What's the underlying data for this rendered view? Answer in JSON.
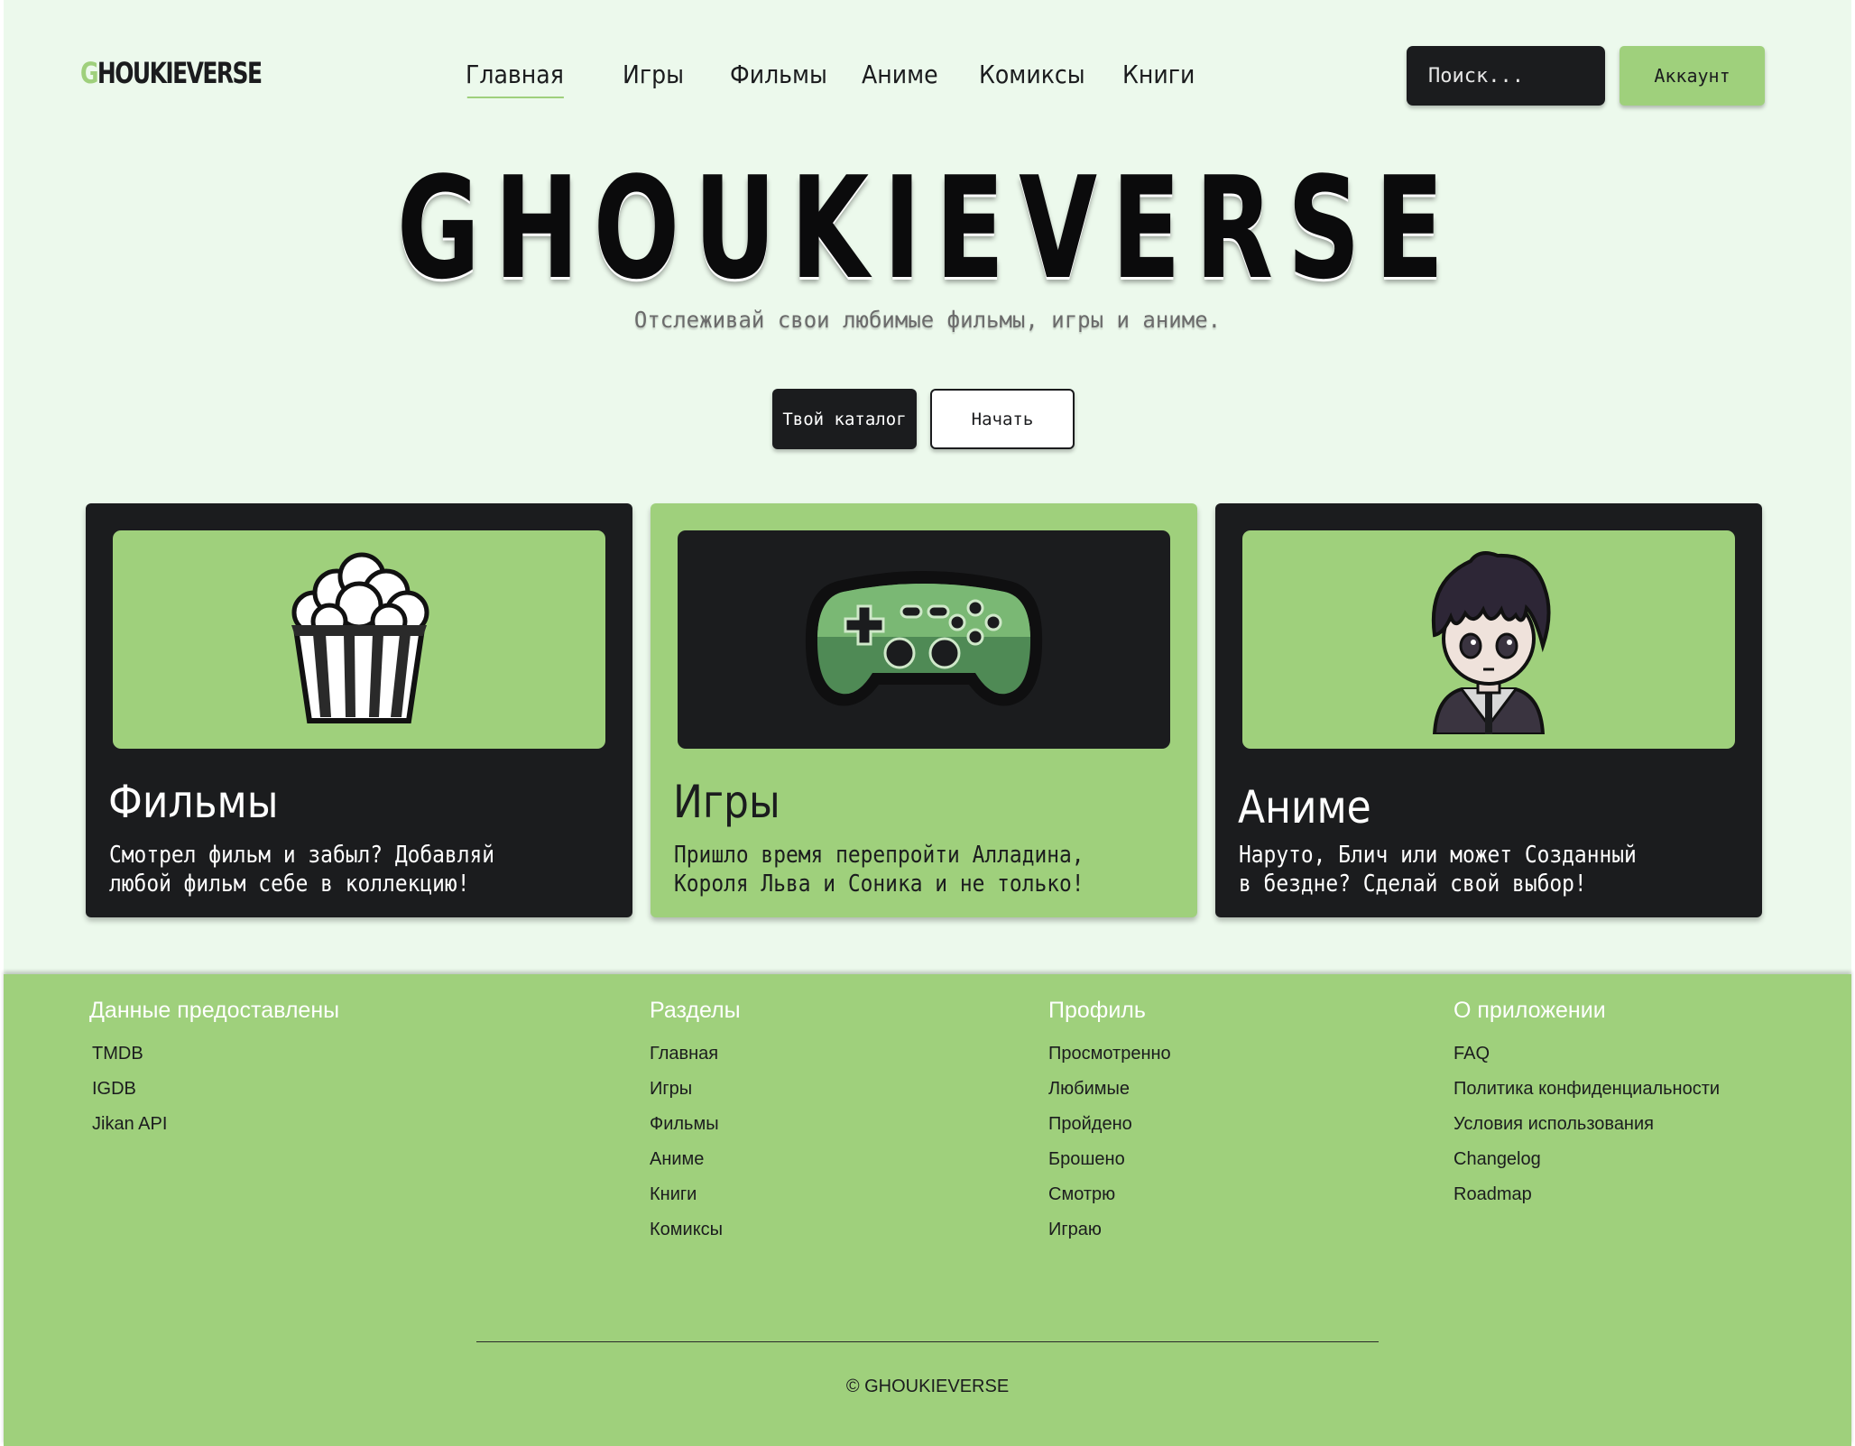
{
  "header": {
    "logo": {
      "first_letter": "G",
      "rest": "HOUKIEVERSE"
    },
    "nav": [
      "Главная",
      "Игры",
      "Фильмы",
      "Аниме",
      "Комиксы",
      "Книги"
    ],
    "active_nav": "Главная",
    "search_placeholder": "Поиск...",
    "account_label": "Аккаунт"
  },
  "hero": {
    "title": "GHOUKIEVERSE",
    "subtitle": "Отслеживай свои любимые фильмы, игры и аниме.",
    "catalog_button": "Твой каталог",
    "start_button": "Начать"
  },
  "cards": [
    {
      "title": "Фильмы",
      "description": [
        "Смотрел фильм и забыл? Добавляй",
        "любой фильм себе в коллекцию!"
      ],
      "icon": "popcorn-icon",
      "theme": "dark"
    },
    {
      "title": "Игры",
      "description": [
        "Пришло время перепройти Алладина,",
        "Короля Льва и Соника и не только!"
      ],
      "icon": "gamepad-icon",
      "theme": "light"
    },
    {
      "title": "Аниме",
      "description": [
        "Наруто, Блич или может Созданный",
        "в бездне? Сделай свой выбор!"
      ],
      "icon": "anime-character-icon",
      "theme": "dark"
    }
  ],
  "footer": {
    "columns": [
      {
        "heading": "Данные предоставлены",
        "links": [
          "TMDB",
          "IGDB",
          "Jikan API"
        ]
      },
      {
        "heading": "Разделы",
        "links": [
          "Главная",
          "Игры",
          "Фильмы",
          "Аниме",
          "Книги",
          "Комиксы"
        ]
      },
      {
        "heading": "Профиль",
        "links": [
          "Просмотренно",
          "Любимые",
          "Пройдено",
          "Брошено",
          "Смотрю",
          "Играю"
        ]
      },
      {
        "heading": "О приложении",
        "links": [
          "FAQ",
          "Политика конфиденциальности",
          "Условия использования",
          "Changelog",
          "Roadmap"
        ]
      }
    ],
    "copyright": "© GHOUKIEVERSE"
  },
  "colors": {
    "background": "#ecf9ec",
    "accent_green": "#9fd07c",
    "dark": "#1b1c1e",
    "white": "#ffffff"
  }
}
